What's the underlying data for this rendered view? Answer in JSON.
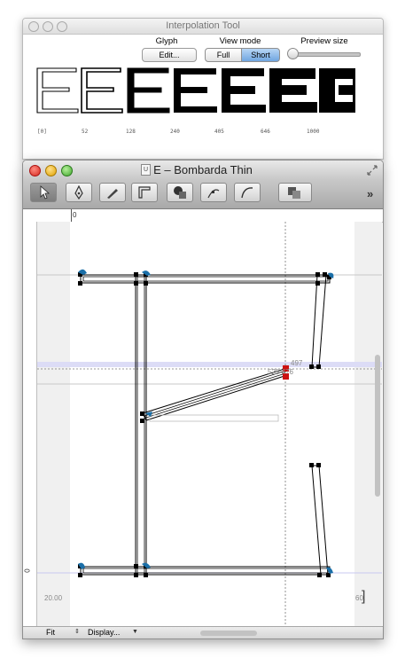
{
  "interpolation_window": {
    "title": "Interpolation Tool",
    "glyph_label": "Glyph",
    "edit_button": "Edit...",
    "view_mode_label": "View mode",
    "view_modes": [
      "Full",
      "Short"
    ],
    "view_mode_selected": "Short",
    "preview_size_label": "Preview size",
    "preview_glyphs": [
      {
        "weight_label": "[0]"
      },
      {
        "weight_label": "52"
      },
      {
        "weight_label": "128"
      },
      {
        "weight_label": "240"
      },
      {
        "weight_label": "405"
      },
      {
        "weight_label": "646"
      },
      {
        "weight_label": "1000"
      }
    ]
  },
  "editor_window": {
    "title": "E – Bombarda Thin",
    "doc_badge": "U",
    "tools": [
      "pointer-tool",
      "pen-tool",
      "knife-tool",
      "measure-tool",
      "shape-tool",
      "node-tool",
      "curve-tool",
      "component-tool"
    ],
    "ruler_zero_label": "0",
    "vruler_zero_label": "0",
    "sidebearing_left": "20.00",
    "sidebearing_right": "60.",
    "coord_readout_1": "497",
    "coord_readout_2": "525 476",
    "zoom_select": "Fit",
    "display_menu": "Display..."
  },
  "colors": {
    "selected_node": "#cc1111",
    "guide_blue": "#c8c8f0",
    "node_black": "#000000",
    "handle_blue": "#1a6fa8"
  }
}
